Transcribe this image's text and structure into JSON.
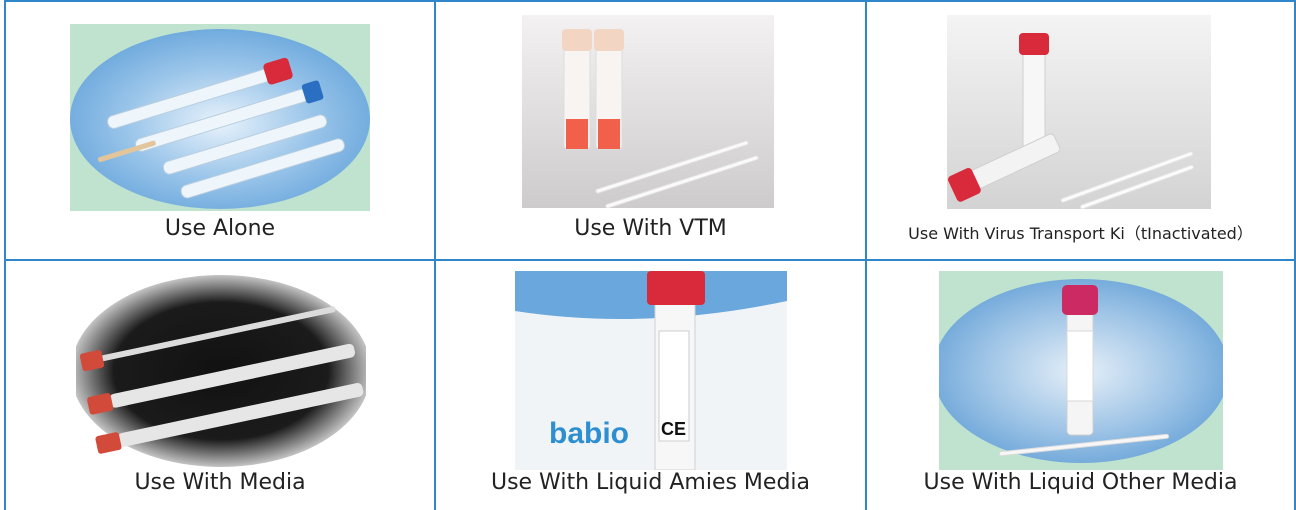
{
  "cells": [
    {
      "caption": "Use Alone",
      "image": "swab-tubes-use-alone-photo"
    },
    {
      "caption": "Use With VTM",
      "image": "vtm-tubes-with-swabs-photo"
    },
    {
      "caption": "Use With Virus Transport Ki（tInactivated）",
      "image": "inactivated-vtm-kit-photo"
    },
    {
      "caption": "Use With Media",
      "image": "swabs-with-media-photo"
    },
    {
      "caption": "Use With Liquid Amies Media",
      "image": "liquid-amies-media-tube-photo",
      "brand": "babio",
      "mark": "CE"
    },
    {
      "caption": "Use With Liquid Other Media",
      "image": "liquid-other-media-tube-photo"
    }
  ],
  "colors": {
    "grid": "#2f86c8",
    "cap_red": "#d82a3a",
    "cap_blue": "#2a6fc2",
    "babio_blue": "#2d8fd0"
  }
}
